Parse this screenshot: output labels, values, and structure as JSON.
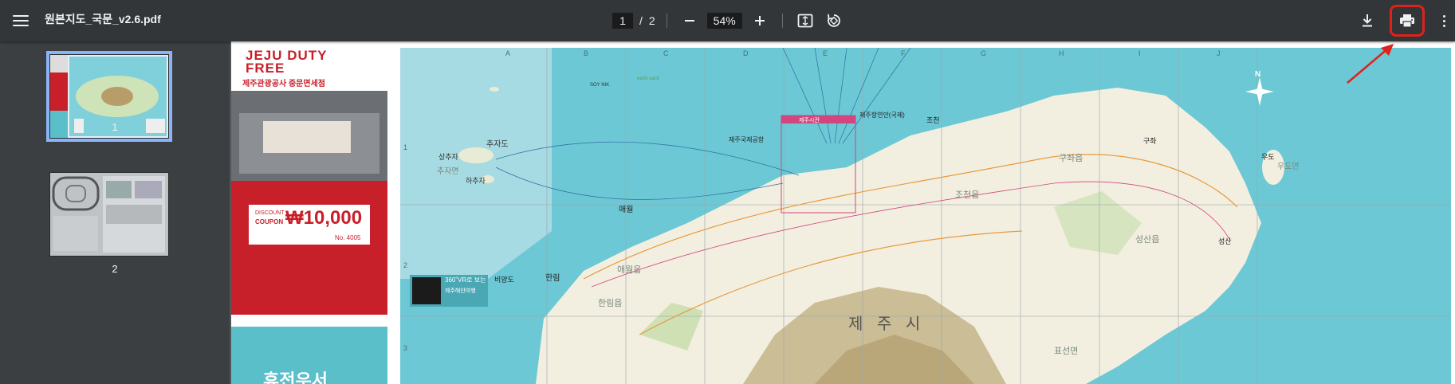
{
  "toolbar": {
    "title": "원본지도_국문_v2.6.pdf",
    "current_page": "1",
    "page_separator": "/",
    "total_pages": "2",
    "zoom": "54%"
  },
  "icons": {
    "menu": "menu-icon",
    "zoom_out": "minus-icon",
    "zoom_in": "plus-icon",
    "fit": "fit-page-icon",
    "rotate": "rotate-icon",
    "download": "download-icon",
    "print": "print-icon",
    "more": "more-vertical-icon"
  },
  "sidebar": {
    "thumbnails": [
      {
        "label": "1",
        "selected": true
      },
      {
        "label": "2",
        "selected": false
      }
    ]
  },
  "map": {
    "grid_cols": [
      "A",
      "B",
      "C",
      "D",
      "E",
      "F",
      "G",
      "H",
      "I",
      "J"
    ],
    "grid_rows": [
      "1",
      "2",
      "3"
    ],
    "labels": {
      "city": "제 주 시",
      "chuja": "추자도",
      "jeju_airport": "제주국제공항",
      "jeju_port": "제주항연안(국제)",
      "jeju_city_hall": "제주시관",
      "aewol": "애월",
      "hallim": "한림",
      "biyangdo": "비양도",
      "jocheon": "조천",
      "gujwa": "구좌",
      "udo": "우도",
      "seongsan": "성산",
      "north": "N",
      "vr_title": "360˚VR로 보는",
      "vr_sub": "제주해안여행",
      "udo_myeon": "우도면",
      "gujwa_eup": "구좌읍",
      "jocheon_eup": "조천읍",
      "seongsan_eup": "성산읍",
      "pyoseon": "표선면",
      "aewol_eup": "애월읍",
      "hallim_eup": "한림읍",
      "sangchuja": "상추자",
      "hachuja": "하추자",
      "chuja_myeon": "추자면",
      "soy_ink": "SOY INK",
      "earth_pack": "earth pack"
    }
  },
  "ad": {
    "brand_top": "JEJU DUTY FREE",
    "brand_sub": "제주관광공사 중문면세점",
    "discount": "DISCOUNT",
    "coupon": "COUPON",
    "amount": "₩10,000",
    "coupon_no": "No. 4005",
    "blue_title": "휴전우서"
  },
  "colors": {
    "toolbar_bg": "#323639",
    "sidebar_bg": "#3c3f42",
    "viewer_bg": "#525659",
    "highlight": "#e0211b",
    "thumb_selected": "#8ab4f8",
    "sea": "#6cc8d5",
    "ad_red": "#c8202a",
    "ad_teal": "#5bbfc9"
  }
}
